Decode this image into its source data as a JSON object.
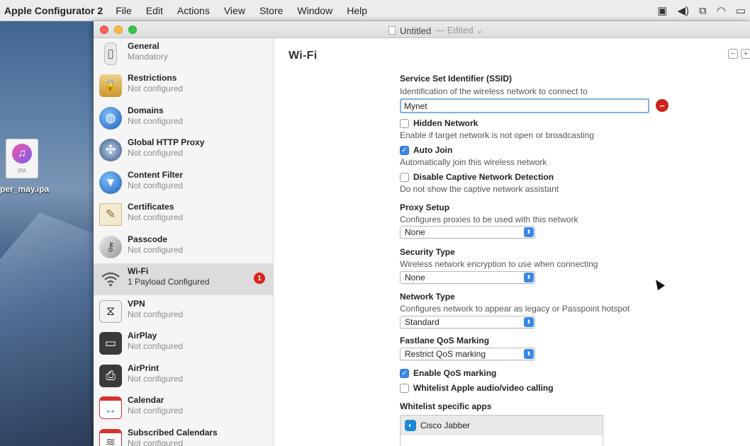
{
  "menubar": {
    "app_name": "Apple Configurator 2",
    "items": [
      "File",
      "Edit",
      "Actions",
      "View",
      "Store",
      "Window",
      "Help"
    ],
    "status_icons": [
      "display-icon",
      "volume-icon",
      "mirroring-icon",
      "wifi-icon",
      "battery-icon"
    ]
  },
  "desktop": {
    "file_icon_ext": "IPA",
    "file_label": "per_may.ipa"
  },
  "window": {
    "title": "Untitled",
    "title_suffix": "— Edited ⌄"
  },
  "sidebar": {
    "items": [
      {
        "title": "General",
        "subtitle": "Mandatory",
        "icon": "general-icon"
      },
      {
        "title": "Restrictions",
        "subtitle": "Not configured",
        "icon": "restrictions-icon"
      },
      {
        "title": "Domains",
        "subtitle": "Not configured",
        "icon": "domains-icon"
      },
      {
        "title": "Global HTTP Proxy",
        "subtitle": "Not configured",
        "icon": "proxy-icon"
      },
      {
        "title": "Content Filter",
        "subtitle": "Not configured",
        "icon": "content-filter-icon"
      },
      {
        "title": "Certificates",
        "subtitle": "Not configured",
        "icon": "certificate-icon"
      },
      {
        "title": "Passcode",
        "subtitle": "Not configured",
        "icon": "passcode-icon"
      },
      {
        "title": "Wi-Fi",
        "subtitle": "1 Payload Configured",
        "icon": "wifi-icon",
        "badge": "1",
        "selected": true
      },
      {
        "title": "VPN",
        "subtitle": "Not configured",
        "icon": "vpn-icon"
      },
      {
        "title": "AirPlay",
        "subtitle": "Not configured",
        "icon": "airplay-icon"
      },
      {
        "title": "AirPrint",
        "subtitle": "Not configured",
        "icon": "airprint-icon"
      },
      {
        "title": "Calendar",
        "subtitle": "Not configured",
        "icon": "calendar-icon"
      },
      {
        "title": "Subscribed Calendars",
        "subtitle": "Not configured",
        "icon": "subscribed-calendar-icon"
      }
    ]
  },
  "main": {
    "title": "Wi-Fi",
    "controls": [
      "−",
      "+"
    ],
    "ssid": {
      "label": "Service Set Identifier (SSID)",
      "desc": "Identification of the wireless network to connect to",
      "value": "Mynet"
    },
    "hidden_network": {
      "label": "Hidden Network",
      "desc": "Enable if target network is not open or broadcasting",
      "checked": false
    },
    "auto_join": {
      "label": "Auto Join",
      "desc": "Automatically join this wireless network",
      "checked": true
    },
    "captive": {
      "label": "Disable Captive Network Detection",
      "desc": "Do not show the captive network assistant",
      "checked": false
    },
    "proxy": {
      "label": "Proxy Setup",
      "desc": "Configures proxies to be used with this network",
      "value": "None"
    },
    "security": {
      "label": "Security Type",
      "desc": "Wireless network encryption to use when connecting",
      "value": "None"
    },
    "network_type": {
      "label": "Network Type",
      "desc": "Configures network to appear as legacy or Passpoint hotspot",
      "value": "Standard"
    },
    "fastlane": {
      "label": "Fastlane QoS Marking",
      "value": "Restrict QoS marking"
    },
    "enable_qos": {
      "label": "Enable QoS marking",
      "checked": true
    },
    "whitelist_calls": {
      "label": "Whitelist Apple audio/video calling",
      "checked": false
    },
    "whitelist_apps": {
      "label": "Whitelist specific apps",
      "apps": [
        "Cisco Jabber"
      ]
    }
  },
  "colors": {
    "accent": "#3b87e6",
    "error": "#d0201c",
    "badge": "#e0201b",
    "selection": "#dcdcdc"
  }
}
